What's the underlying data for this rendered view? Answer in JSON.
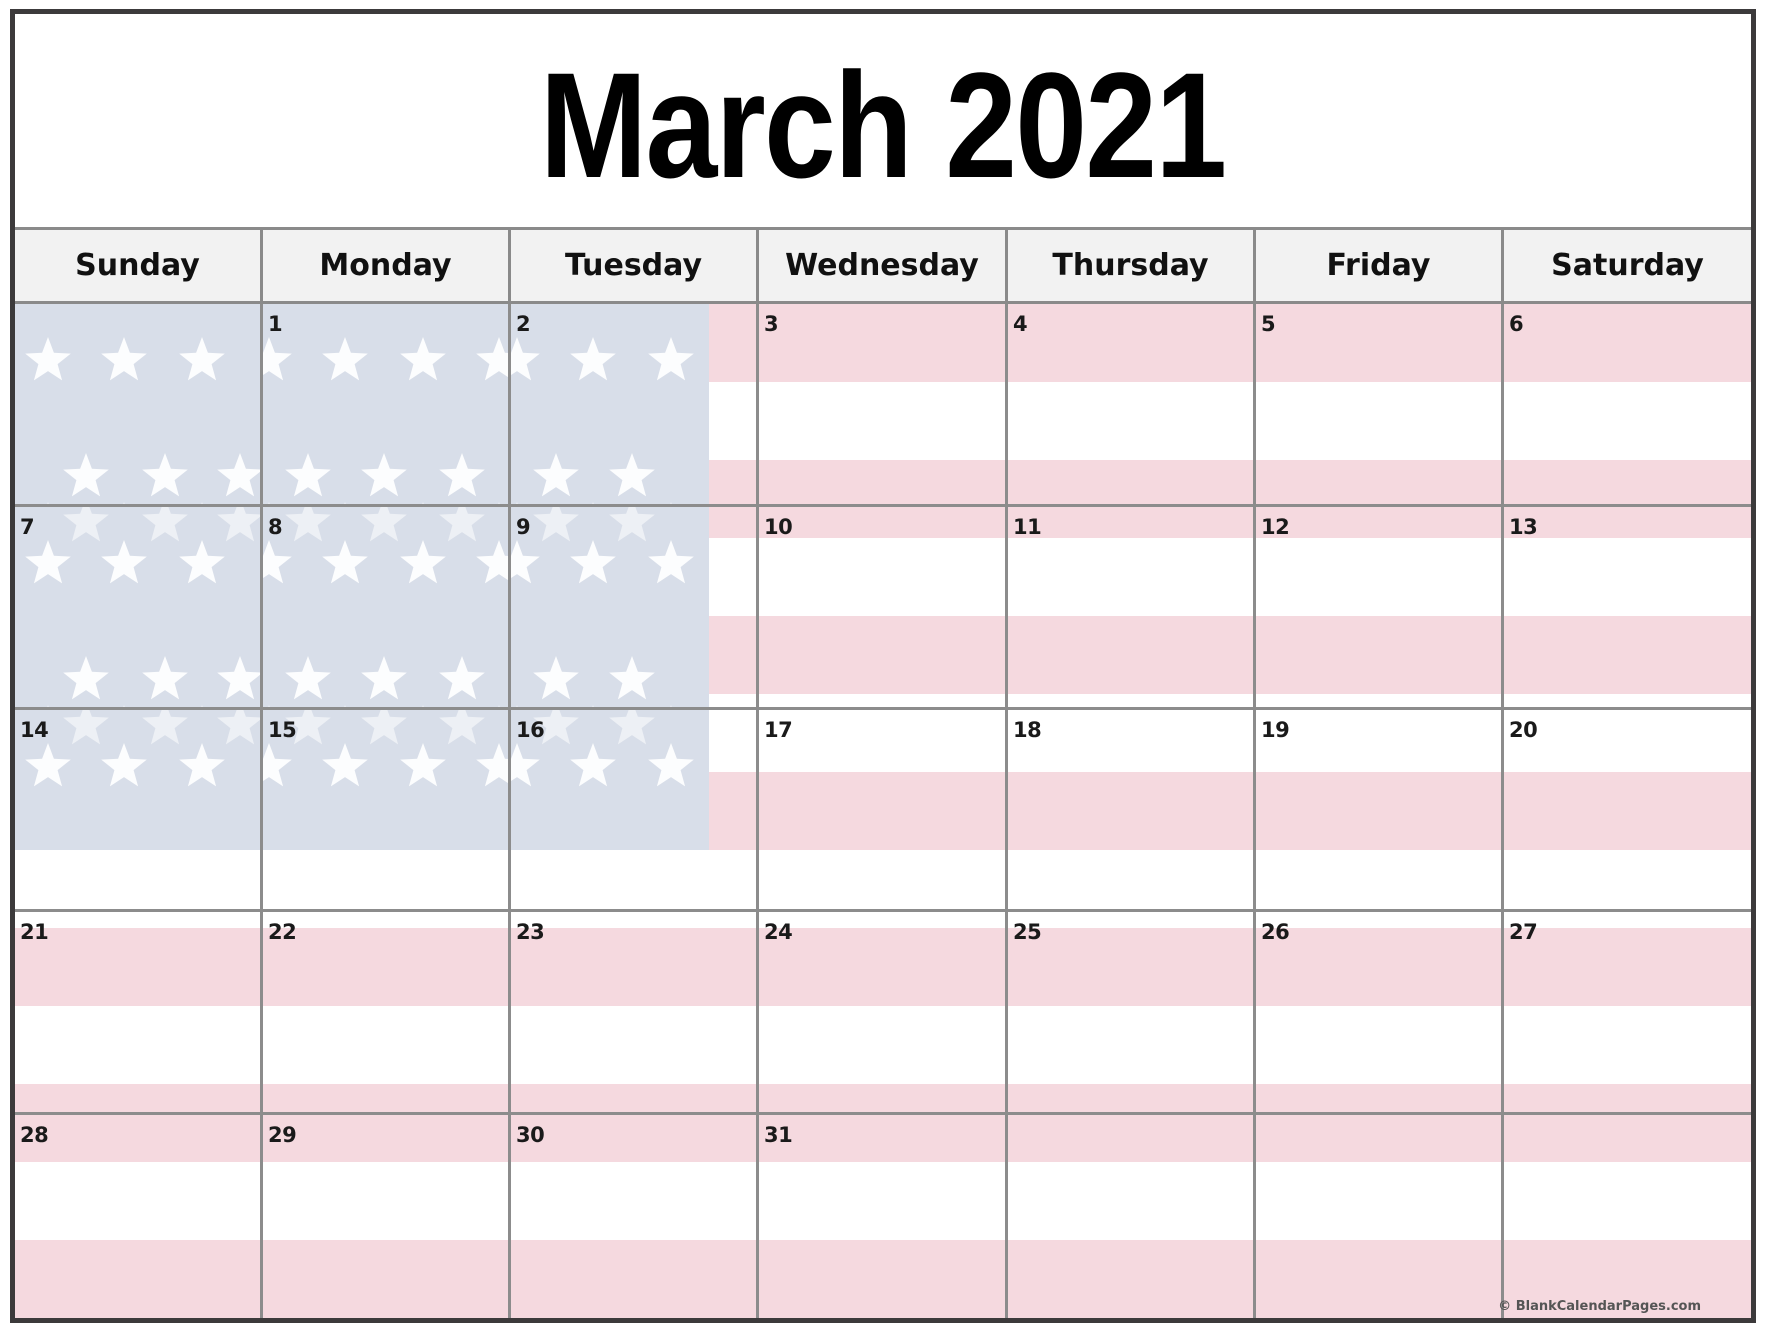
{
  "calendar": {
    "title": "March 2021",
    "month": "March",
    "year": 2021,
    "weekdays": [
      "Sunday",
      "Monday",
      "Tuesday",
      "Wednesday",
      "Thursday",
      "Friday",
      "Saturday"
    ],
    "weeks": [
      [
        "",
        "1",
        "2",
        "3",
        "4",
        "5",
        "6"
      ],
      [
        "7",
        "8",
        "9",
        "10",
        "11",
        "12",
        "13"
      ],
      [
        "14",
        "15",
        "16",
        "17",
        "18",
        "19",
        "20"
      ],
      [
        "21",
        "22",
        "23",
        "24",
        "25",
        "26",
        "27"
      ],
      [
        "28",
        "29",
        "30",
        "31",
        "",
        "",
        ""
      ]
    ],
    "copyright": "© BlankCalendarPages.com"
  },
  "theme": {
    "background_motif": "us-flag",
    "stripe_red": "#f5d9df",
    "stripe_white": "#ffffff",
    "canton_blue": "#d8dee9",
    "star_color": "#ffffff",
    "grid_line": "#8c8c8c",
    "border_dark": "#3c3a3b",
    "header_bg": "#f2f2f2"
  }
}
